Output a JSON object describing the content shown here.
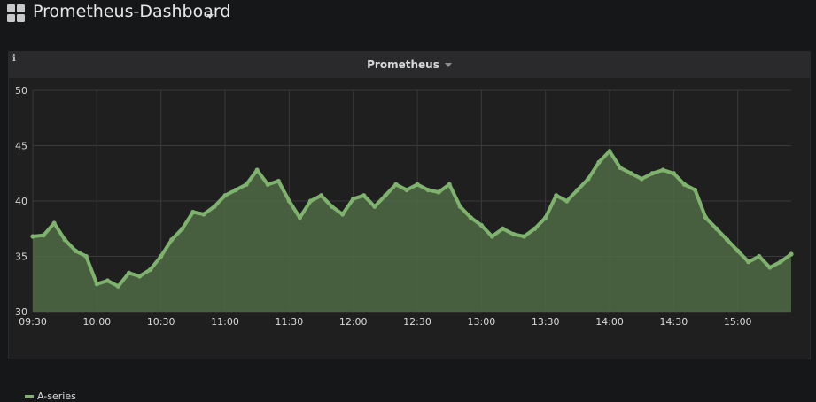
{
  "app": {
    "dashboard_title": "Prometheus-Dashboard"
  },
  "panel": {
    "title": "Prometheus",
    "info_icon": "i"
  },
  "legend": {
    "series_name": "A-series"
  },
  "colors": {
    "series": "#7eb26d",
    "fill": "#4f6a45",
    "grid": "#3a3a3c",
    "text": "#d8d9da"
  },
  "chart_data": {
    "type": "area",
    "title": "Prometheus",
    "xlabel": "",
    "ylabel": "",
    "ylim": [
      30,
      50
    ],
    "y_ticks": [
      30,
      35,
      40,
      45,
      50
    ],
    "x_ticks": [
      "09:30",
      "10:00",
      "10:30",
      "11:00",
      "11:30",
      "12:00",
      "12:30",
      "13:00",
      "13:30",
      "14:00",
      "14:30",
      "15:00"
    ],
    "x_start": "09:30",
    "x_end": "15:25",
    "grid": true,
    "legend_position": "bottom-left",
    "series": [
      {
        "name": "A-series",
        "points": [
          [
            "09:30",
            36.8
          ],
          [
            "09:35",
            36.9
          ],
          [
            "09:40",
            38.0
          ],
          [
            "09:45",
            36.5
          ],
          [
            "09:50",
            35.5
          ],
          [
            "09:55",
            35.0
          ],
          [
            "10:00",
            32.5
          ],
          [
            "10:05",
            32.8
          ],
          [
            "10:10",
            32.3
          ],
          [
            "10:15",
            33.5
          ],
          [
            "10:20",
            33.2
          ],
          [
            "10:25",
            33.8
          ],
          [
            "10:30",
            35.0
          ],
          [
            "10:35",
            36.5
          ],
          [
            "10:40",
            37.5
          ],
          [
            "10:45",
            39.0
          ],
          [
            "10:50",
            38.8
          ],
          [
            "10:55",
            39.5
          ],
          [
            "11:00",
            40.5
          ],
          [
            "11:05",
            41.0
          ],
          [
            "11:10",
            41.5
          ],
          [
            "11:15",
            42.8
          ],
          [
            "11:20",
            41.5
          ],
          [
            "11:25",
            41.8
          ],
          [
            "11:30",
            40.0
          ],
          [
            "11:35",
            38.5
          ],
          [
            "11:40",
            40.0
          ],
          [
            "11:45",
            40.5
          ],
          [
            "11:50",
            39.5
          ],
          [
            "11:55",
            38.8
          ],
          [
            "12:00",
            40.2
          ],
          [
            "12:05",
            40.5
          ],
          [
            "12:10",
            39.5
          ],
          [
            "12:15",
            40.5
          ],
          [
            "12:20",
            41.5
          ],
          [
            "12:25",
            41.0
          ],
          [
            "12:30",
            41.5
          ],
          [
            "12:35",
            41.0
          ],
          [
            "12:40",
            40.8
          ],
          [
            "12:45",
            41.5
          ],
          [
            "12:50",
            39.5
          ],
          [
            "12:55",
            38.5
          ],
          [
            "13:00",
            37.8
          ],
          [
            "13:05",
            36.8
          ],
          [
            "13:10",
            37.5
          ],
          [
            "13:15",
            37.0
          ],
          [
            "13:20",
            36.8
          ],
          [
            "13:25",
            37.5
          ],
          [
            "13:30",
            38.5
          ],
          [
            "13:35",
            40.5
          ],
          [
            "13:40",
            40.0
          ],
          [
            "13:45",
            41.0
          ],
          [
            "13:50",
            42.0
          ],
          [
            "13:55",
            43.5
          ],
          [
            "14:00",
            44.5
          ],
          [
            "14:05",
            43.0
          ],
          [
            "14:10",
            42.5
          ],
          [
            "14:15",
            42.0
          ],
          [
            "14:20",
            42.5
          ],
          [
            "14:25",
            42.8
          ],
          [
            "14:30",
            42.5
          ],
          [
            "14:35",
            41.5
          ],
          [
            "14:40",
            41.0
          ],
          [
            "14:45",
            38.5
          ],
          [
            "14:50",
            37.5
          ],
          [
            "14:55",
            36.5
          ],
          [
            "15:00",
            35.5
          ],
          [
            "15:05",
            34.5
          ],
          [
            "15:10",
            35.0
          ],
          [
            "15:15",
            34.0
          ],
          [
            "15:20",
            34.5
          ],
          [
            "15:25",
            35.2
          ]
        ]
      }
    ]
  }
}
